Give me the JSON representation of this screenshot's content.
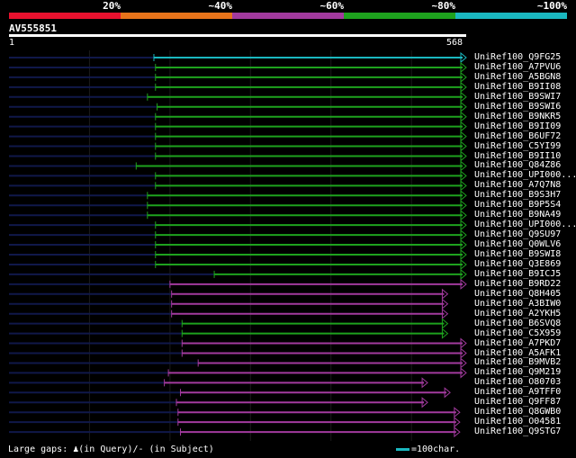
{
  "legend": {
    "labels": [
      "20%",
      "~40%",
      "~60%",
      "~80%",
      "~100%"
    ],
    "colors": [
      "#e8112e",
      "#e8741a",
      "#a23a9e",
      "#1ea21e",
      "#1ab8c0"
    ]
  },
  "query": {
    "name": "AV555851",
    "start_label": "1",
    "end_label": "568",
    "length": 568,
    "bar_color": "#ffffff"
  },
  "colors": {
    "cyan": "#1ab8c0",
    "green": "#1ea21e",
    "purple": "#a23a9e",
    "unaligned": "#10184a",
    "grid": "#1a1a1a"
  },
  "hits": [
    {
      "label": "UniRef100_Q9FG25",
      "color": "cyan",
      "start": 180,
      "end": 568
    },
    {
      "label": "UniRef100_A7PVU6",
      "color": "green",
      "start": 182,
      "end": 568
    },
    {
      "label": "UniRef100_A5BGN8",
      "color": "green",
      "start": 182,
      "end": 568
    },
    {
      "label": "UniRef100_B9II08",
      "color": "green",
      "start": 182,
      "end": 568
    },
    {
      "label": "UniRef100_B9SWI7",
      "color": "green",
      "start": 172,
      "end": 568
    },
    {
      "label": "UniRef100_B9SWI6",
      "color": "green",
      "start": 184,
      "end": 568
    },
    {
      "label": "UniRef100_B9NKR5",
      "color": "green",
      "start": 182,
      "end": 568
    },
    {
      "label": "UniRef100_B9II09",
      "color": "green",
      "start": 182,
      "end": 568
    },
    {
      "label": "UniRef100_B6UF72",
      "color": "green",
      "start": 182,
      "end": 568
    },
    {
      "label": "UniRef100_C5YI99",
      "color": "green",
      "start": 182,
      "end": 568
    },
    {
      "label": "UniRef100_B9II10",
      "color": "green",
      "start": 182,
      "end": 568
    },
    {
      "label": "UniRef100_Q84Z86",
      "color": "green",
      "start": 158,
      "end": 568
    },
    {
      "label": "UniRef100_UPI000...",
      "color": "green",
      "start": 182,
      "end": 568
    },
    {
      "label": "UniRef100_A7Q7N8",
      "color": "green",
      "start": 182,
      "end": 568
    },
    {
      "label": "UniRef100_B9S3H7",
      "color": "green",
      "start": 172,
      "end": 568
    },
    {
      "label": "UniRef100_B9P5S4",
      "color": "green",
      "start": 172,
      "end": 568
    },
    {
      "label": "UniRef100_B9NA49",
      "color": "green",
      "start": 172,
      "end": 568
    },
    {
      "label": "UniRef100_UPI000...",
      "color": "green",
      "start": 182,
      "end": 568
    },
    {
      "label": "UniRef100_Q9SU97",
      "color": "green",
      "start": 182,
      "end": 568
    },
    {
      "label": "UniRef100_Q0WLV6",
      "color": "green",
      "start": 182,
      "end": 568
    },
    {
      "label": "UniRef100_B9SWI8",
      "color": "green",
      "start": 182,
      "end": 568
    },
    {
      "label": "UniRef100_Q3E869",
      "color": "green",
      "start": 182,
      "end": 568
    },
    {
      "label": "UniRef100_B9ICJ5",
      "color": "green",
      "start": 255,
      "end": 568
    },
    {
      "label": "UniRef100_B9RD22",
      "color": "purple",
      "start": 200,
      "end": 568
    },
    {
      "label": "UniRef100_Q8H405",
      "color": "purple",
      "start": 202,
      "end": 545
    },
    {
      "label": "UniRef100_A3BIW0",
      "color": "purple",
      "start": 202,
      "end": 545
    },
    {
      "label": "UniRef100_A2YKH5",
      "color": "purple",
      "start": 202,
      "end": 545
    },
    {
      "label": "UniRef100_B6SVQ8",
      "color": "green",
      "start": 215,
      "end": 545
    },
    {
      "label": "UniRef100_C5X959",
      "color": "green",
      "start": 215,
      "end": 545
    },
    {
      "label": "UniRef100_A7PKD7",
      "color": "purple",
      "start": 215,
      "end": 568
    },
    {
      "label": "UniRef100_A5AFK1",
      "color": "purple",
      "start": 215,
      "end": 568
    },
    {
      "label": "UniRef100_B9MVB2",
      "color": "purple",
      "start": 235,
      "end": 568
    },
    {
      "label": "UniRef100_Q9M219",
      "color": "purple",
      "start": 198,
      "end": 568
    },
    {
      "label": "UniRef100_O80703",
      "color": "purple",
      "start": 193,
      "end": 520
    },
    {
      "label": "UniRef100_A9TFF0",
      "color": "purple",
      "start": 213,
      "end": 548
    },
    {
      "label": "UniRef100_Q9FF87",
      "color": "purple",
      "start": 208,
      "end": 520
    },
    {
      "label": "UniRef100_Q8GWB0",
      "color": "purple",
      "start": 210,
      "end": 560
    },
    {
      "label": "UniRef100_O04581",
      "color": "purple",
      "start": 210,
      "end": 560
    },
    {
      "label": "UniRef100_Q9STG7",
      "color": "purple",
      "start": 213,
      "end": 560
    }
  ],
  "footer": {
    "gaps_text": "Large gaps: ♟(in Query)/- (in Subject)",
    "key_text": "=100char."
  }
}
